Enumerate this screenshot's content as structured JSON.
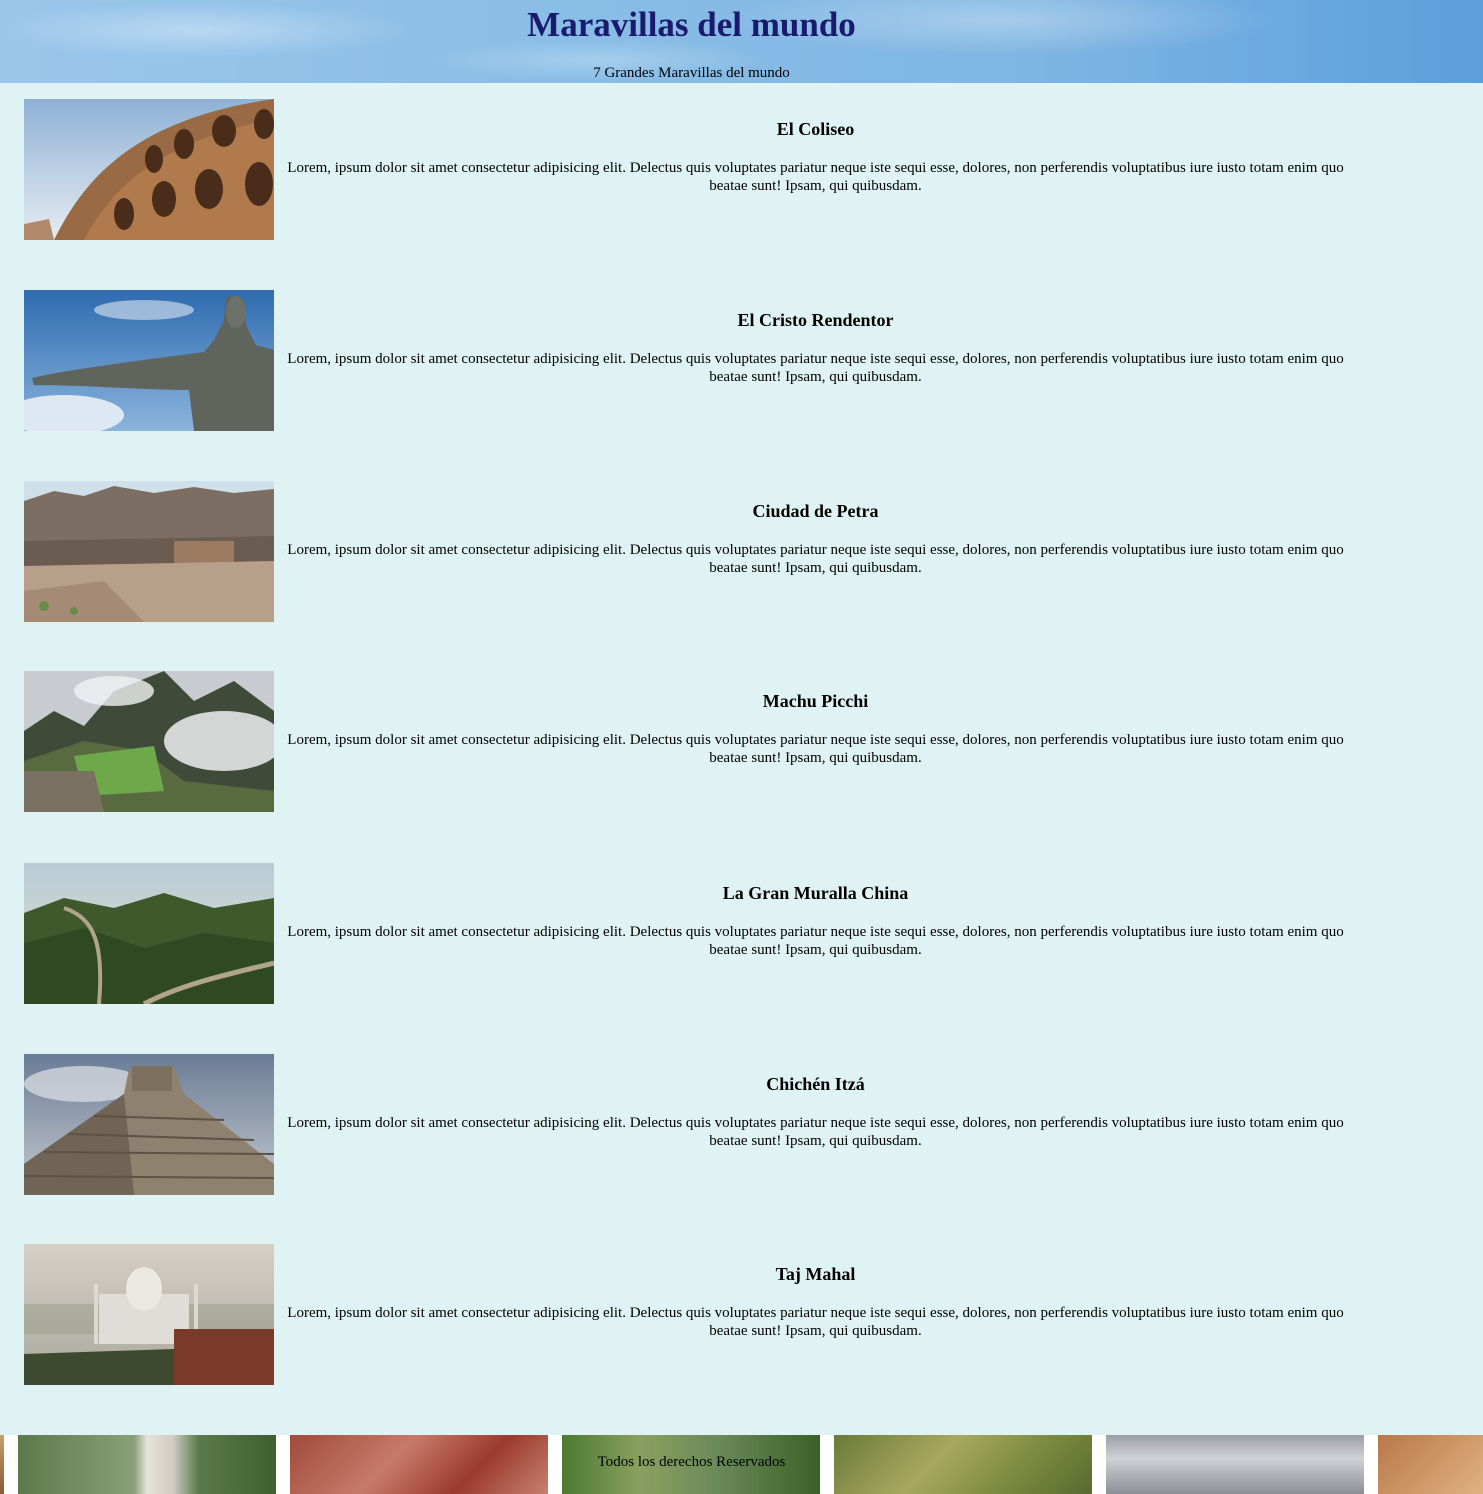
{
  "header": {
    "title": "Maravillas del mundo",
    "subtitle": "7 Grandes Maravillas del mundo"
  },
  "wonders": [
    {
      "name": "El Coliseo",
      "description": "Lorem, ipsum dolor sit amet consectetur adipisicing elit. Delectus quis voluptates pariatur neque iste sequi esse, dolores, non perferendis voluptatibus iure iusto totam enim quo beatae sunt! Ipsam, qui quibusdam."
    },
    {
      "name": "El Cristo Rendentor",
      "description": "Lorem, ipsum dolor sit amet consectetur adipisicing elit. Delectus quis voluptates pariatur neque iste sequi esse, dolores, non perferendis voluptatibus iure iusto totam enim quo beatae sunt! Ipsam, qui quibusdam."
    },
    {
      "name": "Ciudad de Petra",
      "description": "Lorem, ipsum dolor sit amet consectetur adipisicing elit. Delectus quis voluptates pariatur neque iste sequi esse, dolores, non perferendis voluptatibus iure iusto totam enim quo beatae sunt! Ipsam, qui quibusdam."
    },
    {
      "name": "Machu Picchi",
      "description": "Lorem, ipsum dolor sit amet consectetur adipisicing elit. Delectus quis voluptates pariatur neque iste sequi esse, dolores, non perferendis voluptatibus iure iusto totam enim quo beatae sunt! Ipsam, qui quibusdam."
    },
    {
      "name": "La Gran Muralla China",
      "description": "Lorem, ipsum dolor sit amet consectetur adipisicing elit. Delectus quis voluptates pariatur neque iste sequi esse, dolores, non perferendis voluptatibus iure iusto totam enim quo beatae sunt! Ipsam, qui quibusdam."
    },
    {
      "name": "Chichén Itzá",
      "description": "Lorem, ipsum dolor sit amet consectetur adipisicing elit. Delectus quis voluptates pariatur neque iste sequi esse, dolores, non perferendis voluptatibus iure iusto totam enim quo beatae sunt! Ipsam, qui quibusdam."
    },
    {
      "name": "Taj Mahal",
      "description": "Lorem, ipsum dolor sit amet consectetur adipisicing elit. Delectus quis voluptates pariatur neque iste sequi esse, dolores, non perferendis voluptatibus iure iusto totam enim quo beatae sunt! Ipsam, qui quibusdam."
    }
  ],
  "footer": {
    "copyright": "Todos los derechos Reservados"
  }
}
